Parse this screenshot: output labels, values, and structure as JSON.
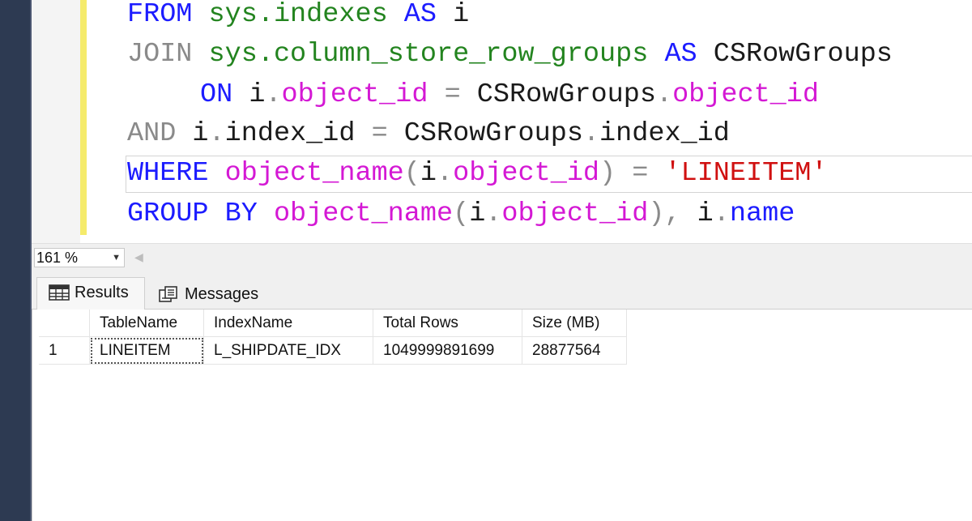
{
  "editor": {
    "lines": [
      [
        {
          "text": "FROM",
          "cls": "kw"
        },
        {
          "text": " ",
          "cls": "plain"
        },
        {
          "text": "sys.indexes",
          "cls": "green"
        },
        {
          "text": " ",
          "cls": "plain"
        },
        {
          "text": "AS",
          "cls": "kw"
        },
        {
          "text": " i",
          "cls": "plain"
        }
      ],
      [
        {
          "text": "JOIN",
          "cls": "gray"
        },
        {
          "text": " ",
          "cls": "plain"
        },
        {
          "text": "sys.column_store_row_groups",
          "cls": "green"
        },
        {
          "text": " ",
          "cls": "plain"
        },
        {
          "text": "AS",
          "cls": "kw"
        },
        {
          "text": " CSRowGroups",
          "cls": "plain"
        }
      ],
      [
        {
          "text": "ON",
          "cls": "kw"
        },
        {
          "text": " i",
          "cls": "plain"
        },
        {
          "text": ".",
          "cls": "gray"
        },
        {
          "text": "object_id",
          "cls": "fn"
        },
        {
          "text": " ",
          "cls": "plain"
        },
        {
          "text": "=",
          "cls": "gray"
        },
        {
          "text": " CSRowGroups",
          "cls": "plain"
        },
        {
          "text": ".",
          "cls": "gray"
        },
        {
          "text": "object_id",
          "cls": "fn"
        }
      ],
      [
        {
          "text": "AND",
          "cls": "gray"
        },
        {
          "text": " i",
          "cls": "plain"
        },
        {
          "text": ".",
          "cls": "gray"
        },
        {
          "text": "index_id",
          "cls": "plain"
        },
        {
          "text": " ",
          "cls": "plain"
        },
        {
          "text": "=",
          "cls": "gray"
        },
        {
          "text": " CSRowGroups",
          "cls": "plain"
        },
        {
          "text": ".",
          "cls": "gray"
        },
        {
          "text": "index_id",
          "cls": "plain"
        }
      ],
      [
        {
          "text": "WHERE",
          "cls": "kw"
        },
        {
          "text": " ",
          "cls": "plain"
        },
        {
          "text": "object_name",
          "cls": "fn"
        },
        {
          "text": "(",
          "cls": "gray"
        },
        {
          "text": "i",
          "cls": "plain"
        },
        {
          "text": ".",
          "cls": "gray"
        },
        {
          "text": "object_id",
          "cls": "fn"
        },
        {
          "text": ")",
          "cls": "gray"
        },
        {
          "text": " ",
          "cls": "plain"
        },
        {
          "text": "=",
          "cls": "gray"
        },
        {
          "text": " ",
          "cls": "plain"
        },
        {
          "text": "'LINEITEM'",
          "cls": "str"
        }
      ],
      [
        {
          "text": "GROUP BY",
          "cls": "kw"
        },
        {
          "text": " ",
          "cls": "plain"
        },
        {
          "text": "object_name",
          "cls": "fn"
        },
        {
          "text": "(",
          "cls": "gray"
        },
        {
          "text": "i",
          "cls": "plain"
        },
        {
          "text": ".",
          "cls": "gray"
        },
        {
          "text": "object_id",
          "cls": "fn"
        },
        {
          "text": "),",
          "cls": "gray"
        },
        {
          "text": " i",
          "cls": "plain"
        },
        {
          "text": ".",
          "cls": "gray"
        },
        {
          "text": "name",
          "cls": "kw"
        }
      ]
    ]
  },
  "zoom": {
    "value": "161 %"
  },
  "tabs": {
    "results": "Results",
    "messages": "Messages"
  },
  "grid": {
    "columns": [
      "TableName",
      "IndexName",
      "Total Rows",
      "Size (MB)"
    ],
    "rows": [
      {
        "num": "1",
        "cells": [
          "LINEITEM",
          "L_SHIPDATE_IDX",
          "1049999891699",
          "28877564"
        ]
      }
    ]
  }
}
